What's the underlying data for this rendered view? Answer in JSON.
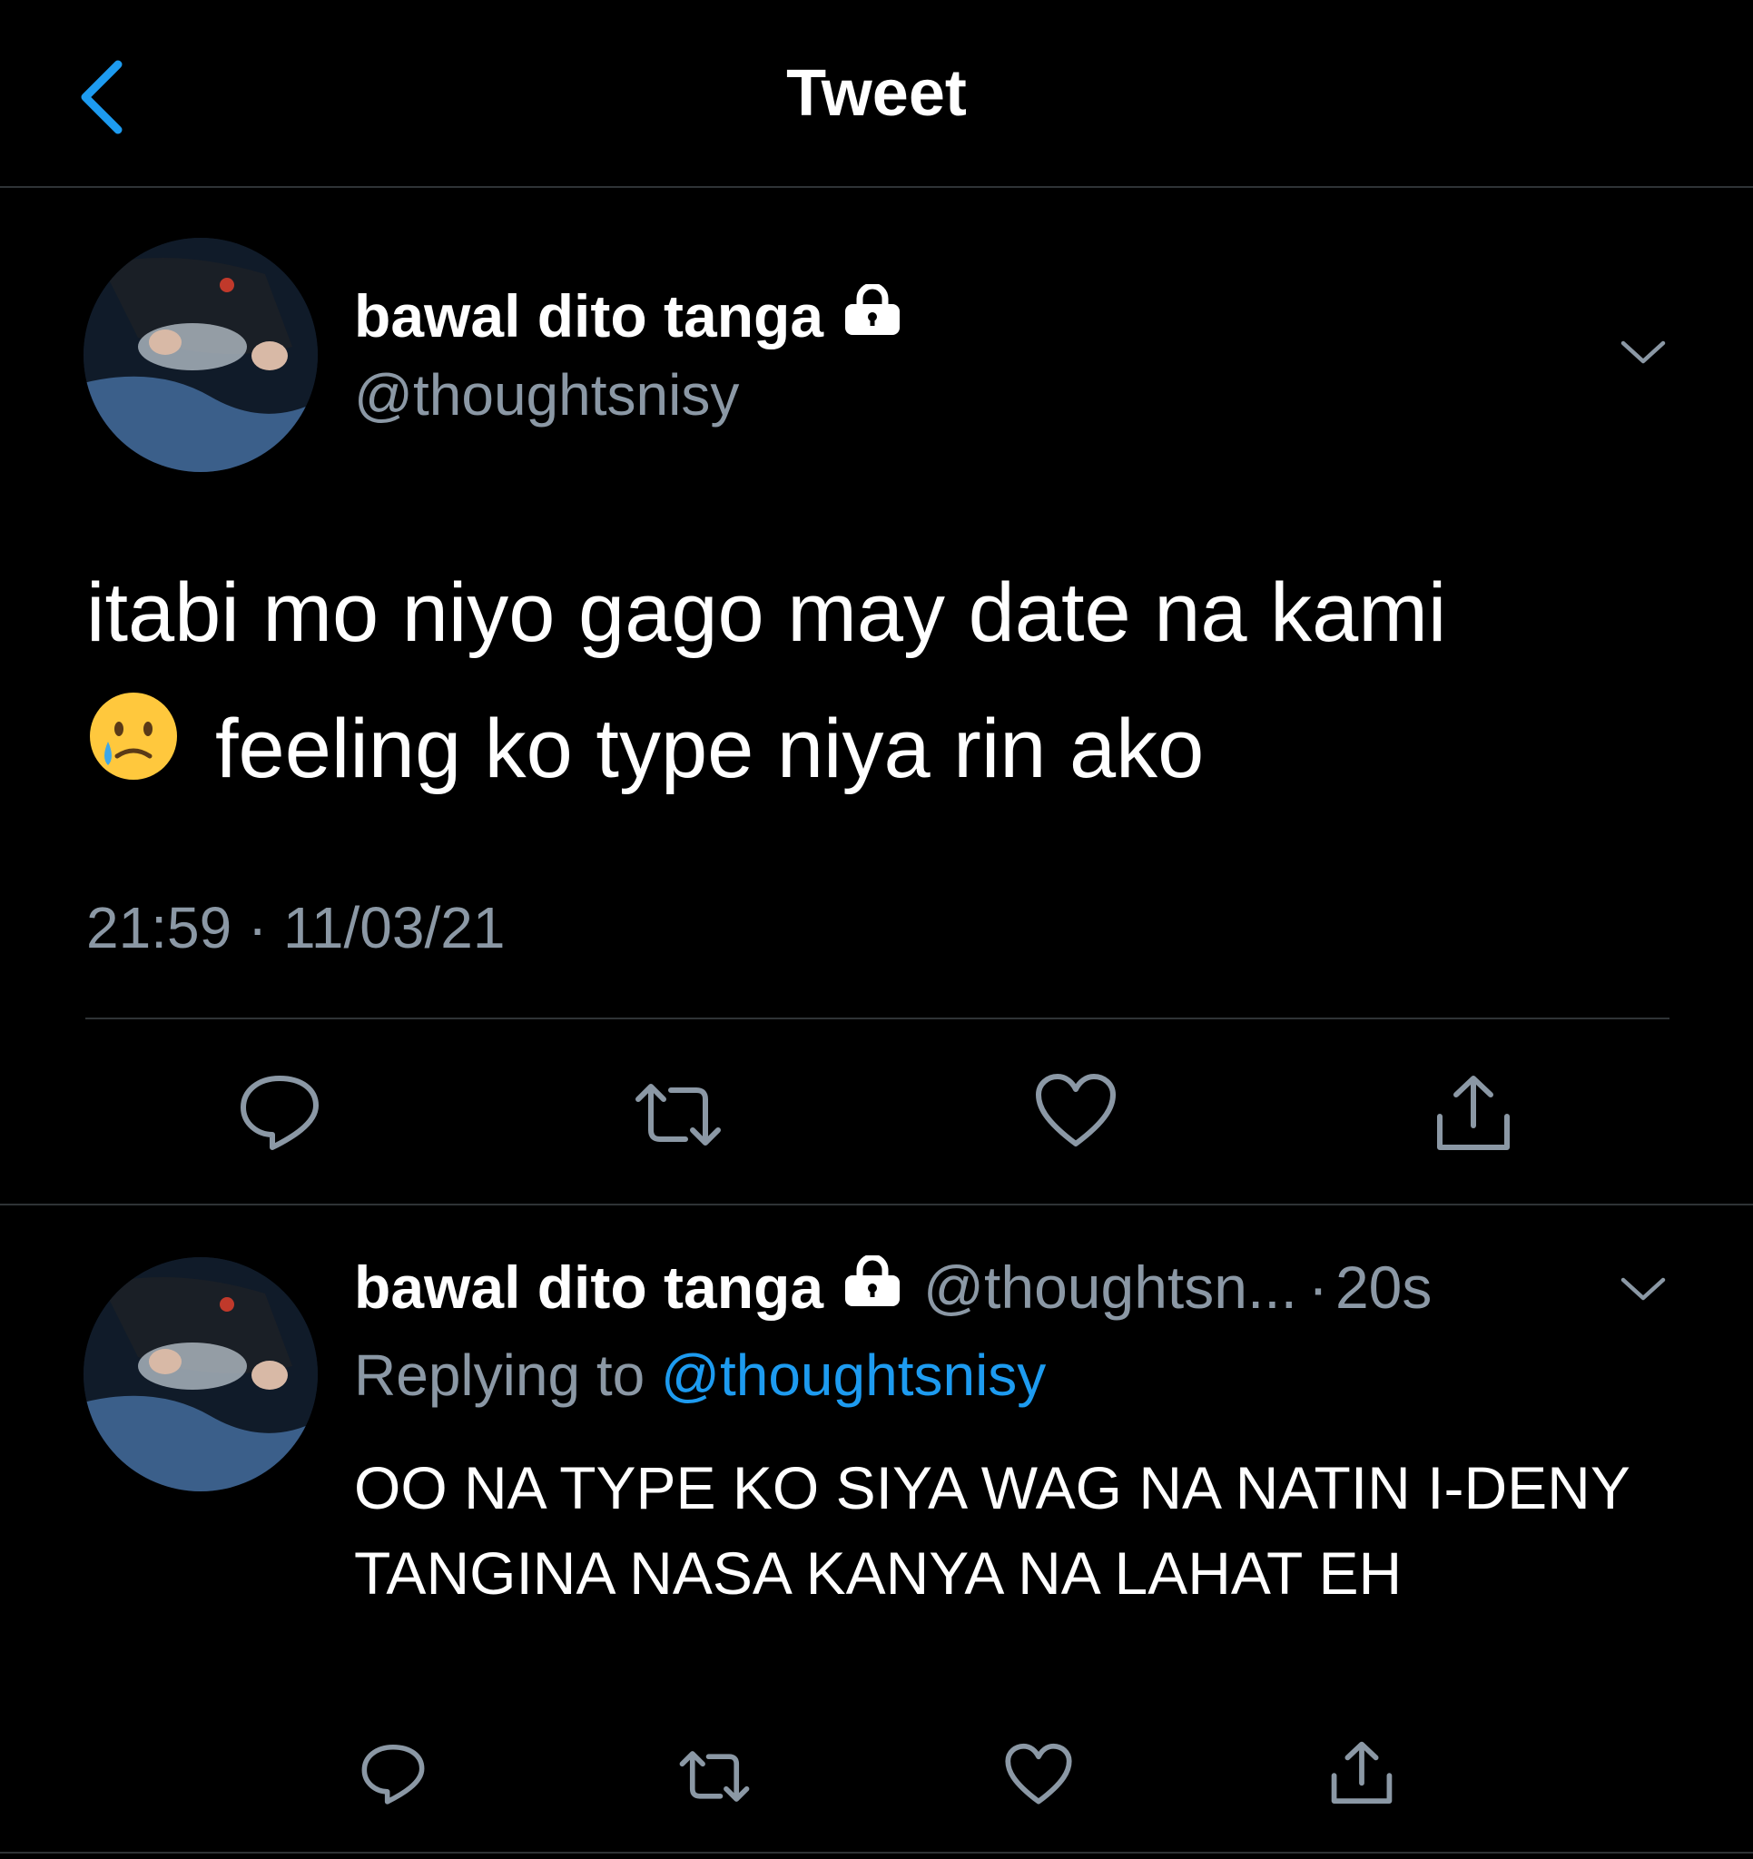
{
  "header": {
    "title": "Tweet",
    "back_icon": "chevron-left-icon"
  },
  "colors": {
    "accent": "#1d9bf0",
    "secondary_text": "#8b98a5",
    "divider": "#2f3336",
    "background": "#000000"
  },
  "main_tweet": {
    "display_name": "bawal dito tanga",
    "handle": "@thoughtsnisy",
    "text_line1": "itabi mo niyo gago may date na kami",
    "emoji": "crying-face-emoji",
    "text_line2": "feeling ko type niya rin ako",
    "timestamp": "21:59 · 11/03/21",
    "protected": true
  },
  "reply_tweet": {
    "display_name": "bawal dito tanga",
    "handle": "@thoughtsn...",
    "separator": "·",
    "time": "20s",
    "replying_prefix": "Replying to",
    "replying_to": "@thoughtsnisy",
    "text": "OO NA TYPE KO SIYA WAG NA NATIN I-DENY TANGINA NASA KANYA NA LAHAT EH",
    "protected": true
  },
  "actions": [
    "reply-icon",
    "retweet-icon",
    "like-icon",
    "share-icon"
  ]
}
